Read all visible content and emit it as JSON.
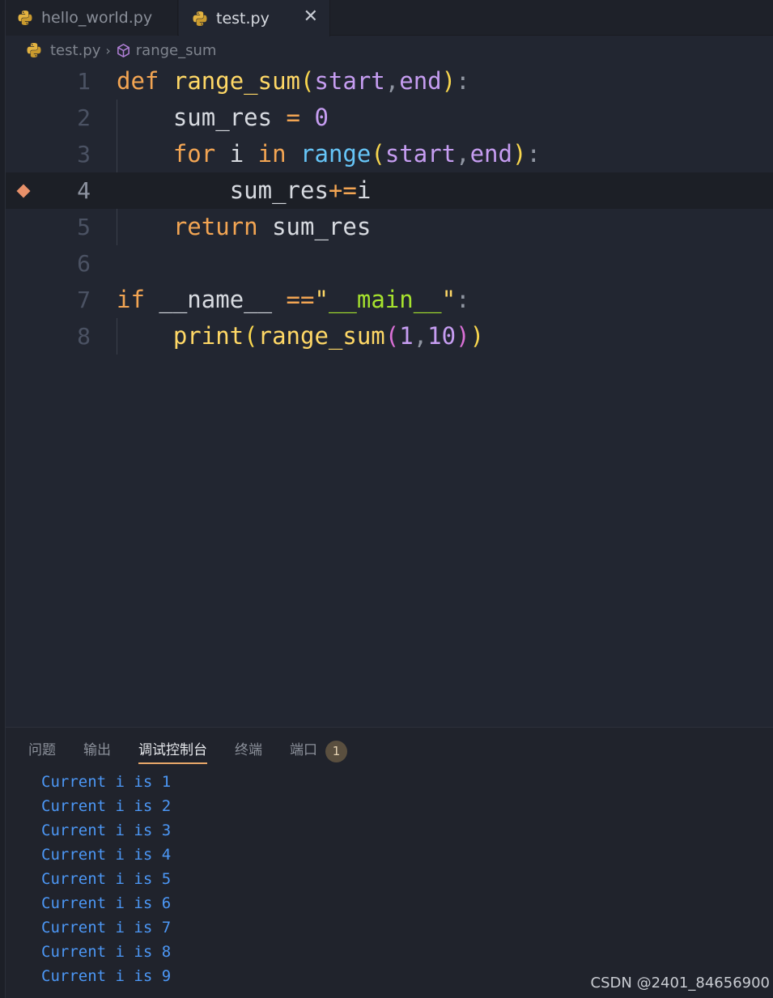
{
  "tabs": [
    {
      "label": "hello_world.py",
      "active": false
    },
    {
      "label": "test.py",
      "active": true
    }
  ],
  "tab_close_glyph": "✕",
  "breadcrumb": {
    "file": "test.py",
    "symbol": "range_sum"
  },
  "editor": {
    "current_line": 4,
    "breakpoint_line": 4,
    "lines": [
      {
        "n": "1"
      },
      {
        "n": "2"
      },
      {
        "n": "3"
      },
      {
        "n": "4"
      },
      {
        "n": "5"
      },
      {
        "n": "6"
      },
      {
        "n": "7"
      },
      {
        "n": "8"
      }
    ],
    "tokens": {
      "l1": [
        "def",
        " ",
        "range_sum",
        "(",
        "start",
        ",",
        "end",
        ")",
        ":"
      ],
      "l2": [
        "    ",
        "sum_res",
        " ",
        "=",
        " ",
        "0"
      ],
      "l3": [
        "    ",
        "for",
        " ",
        "i",
        " ",
        "in",
        " ",
        "range",
        "(",
        "start",
        ",",
        "end",
        ")",
        ":"
      ],
      "l4": [
        "        ",
        "sum_res",
        "+=",
        "i"
      ],
      "l5": [
        "    ",
        "return",
        " ",
        "sum_res"
      ],
      "l7": [
        "if",
        " ",
        "__name__",
        " ",
        "==",
        "\"",
        "__main__",
        "\"",
        ":"
      ],
      "l8": [
        "    ",
        "print",
        "(",
        "range_sum",
        "(",
        "1",
        ",",
        "10",
        ")",
        ")"
      ]
    }
  },
  "panel": {
    "tabs": [
      "问题",
      "输出",
      "调试控制台",
      "终端",
      "端口"
    ],
    "active_tab": "调试控制台",
    "ports_badge": "1",
    "output": [
      "Current i is 1",
      "Current i is 2",
      "Current i is 3",
      "Current i is 4",
      "Current i is 5",
      "Current i is 6",
      "Current i is 7",
      "Current i is 8",
      "Current i is 9"
    ]
  },
  "watermark": "CSDN @2401_84656900",
  "colors": {
    "keyword": "#f3a553",
    "function": "#ffd866",
    "builtin": "#66c5f7",
    "parameter": "#c69df1",
    "string": "#a6e22e",
    "console_output": "#4c97f5",
    "active_tab_underline": "#e8a86a",
    "breakpoint": "#e8916a"
  }
}
